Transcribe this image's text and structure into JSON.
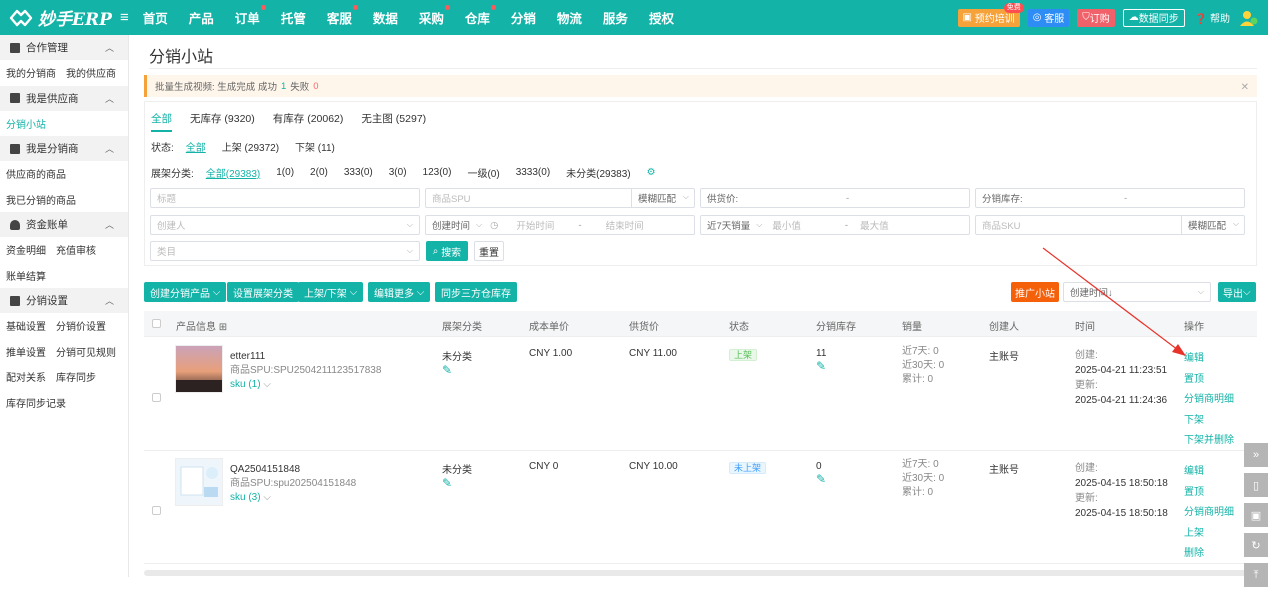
{
  "header": {
    "logo_text": "妙手ERP",
    "nav": [
      {
        "label": "首页",
        "dot": false
      },
      {
        "label": "产品",
        "dot": false
      },
      {
        "label": "订单",
        "dot": true
      },
      {
        "label": "托管",
        "dot": false
      },
      {
        "label": "客服",
        "dot": true
      },
      {
        "label": "数据",
        "dot": false
      },
      {
        "label": "采购",
        "dot": true
      },
      {
        "label": "仓库",
        "dot": true
      },
      {
        "label": "分销",
        "dot": false
      },
      {
        "label": "物流",
        "dot": false
      },
      {
        "label": "服务",
        "dot": false
      },
      {
        "label": "授权",
        "dot": false
      }
    ],
    "training_label": "预约培训",
    "training_badge": "免费",
    "service_label": "客服",
    "order_label": "订购",
    "sync_label": "数据同步",
    "help_label": "帮助"
  },
  "sidebar": {
    "groups": [
      {
        "title": "合作管理",
        "rows": [
          [
            "我的分销商",
            "我的供应商"
          ]
        ]
      },
      {
        "title": "我是供应商",
        "rows": [
          [
            "分销小站"
          ]
        ]
      },
      {
        "title": "我是分销商",
        "rows": [
          [
            "供应商的商品"
          ],
          [
            "我已分销的商品"
          ]
        ]
      },
      {
        "title": "资金账单",
        "rows": [
          [
            "资金明细",
            "充值审核"
          ],
          [
            "账单结算"
          ]
        ]
      },
      {
        "title": "分销设置",
        "rows": [
          [
            "基础设置",
            "分销价设置"
          ],
          [
            "推单设置",
            "分销可见规则"
          ],
          [
            "配对关系",
            "库存同步"
          ],
          [
            "库存同步记录"
          ]
        ]
      }
    ],
    "active_item": "分销小站"
  },
  "page": {
    "title": "分销小站",
    "notice": {
      "label": "批量生成视频:",
      "status": "生成完成",
      "success_label": "成功",
      "success_count": "1",
      "fail_label": "失败",
      "fail_count": "0"
    }
  },
  "filters": {
    "tabs": [
      "全部",
      "无库存 (9320)",
      "有库存 (20062)",
      "无主图 (5297)"
    ],
    "status_label": "状态:",
    "status_options": [
      "全部",
      "上架 (29372)",
      "下架 (11)"
    ],
    "shelf_label": "展架分类:",
    "shelf_options": [
      "全部(29383)",
      "1(0)",
      "2(0)",
      "333(0)",
      "3(0)",
      "123(0)",
      "一级(0)",
      "3333(0)",
      "未分类(29383)"
    ],
    "title_ph": "标题",
    "spu_ph": "商品SPU",
    "fuzzy": "模糊匹配",
    "supply_price_label": "供货价:",
    "stock_label": "分销库存:",
    "dash": "-",
    "creator_ph": "创建人",
    "create_time": "创建时间",
    "start_ph": "开始时间",
    "end_ph": "结束时间",
    "sales7": "近7天销量",
    "min_ph": "最小值",
    "max_ph": "最大值",
    "sku_ph": "商品SKU",
    "category_ph": "类目",
    "search_btn": "搜索",
    "reset_btn": "重置"
  },
  "toolbar": {
    "create": "创建分销产品",
    "set_shelf": "设置展架分类",
    "onoff": "上架/下架",
    "edit_more": "编辑更多",
    "sync_stock": "同步三方仓库存",
    "promote": "推广小站",
    "sort_ph": "创建时间↓",
    "export": "导出"
  },
  "table": {
    "headers": [
      "产品信息",
      "展架分类",
      "成本单价",
      "供货价",
      "状态",
      "分销库存",
      "销量",
      "创建人",
      "时间",
      "操作"
    ],
    "rows": [
      {
        "name": "etter111",
        "spu_label": "商品SPU:",
        "spu": "SPU2504211123517838",
        "sku": "sku (1)",
        "shelf": "未分类",
        "cost": "CNY 1.00",
        "supply": "CNY 11.00",
        "status": "上架",
        "status_on": true,
        "stock": "11",
        "sales": [
          "近7天: 0",
          "近30天: 0",
          "累计: 0"
        ],
        "creator": "主账号",
        "created_label": "创建:",
        "created": "2025-04-21 11:23:51",
        "updated_label": "更新:",
        "updated": "2025-04-21 11:24:36",
        "ops": [
          "编辑",
          "置顶",
          "分销商明细",
          "下架",
          "下架并删除"
        ]
      },
      {
        "name": "QA2504151848",
        "spu_label": "商品SPU:",
        "spu": "spu202504151848",
        "sku": "sku (3)",
        "shelf": "未分类",
        "cost": "CNY 0",
        "supply": "CNY 10.00",
        "status": "未上架",
        "status_on": false,
        "stock": "0",
        "sales": [
          "近7天: 0",
          "近30天: 0",
          "累计: 0"
        ],
        "creator": "主账号",
        "created_label": "创建:",
        "created": "2025-04-15 18:50:18",
        "updated_label": "更新:",
        "updated": "2025-04-15 18:50:18",
        "ops": [
          "编辑",
          "置顶",
          "分销商明细",
          "上架",
          "删除"
        ]
      }
    ]
  },
  "colors": {
    "brand": "#13b3a8",
    "orange": "#f5600b",
    "arrow": "#e8332a"
  }
}
